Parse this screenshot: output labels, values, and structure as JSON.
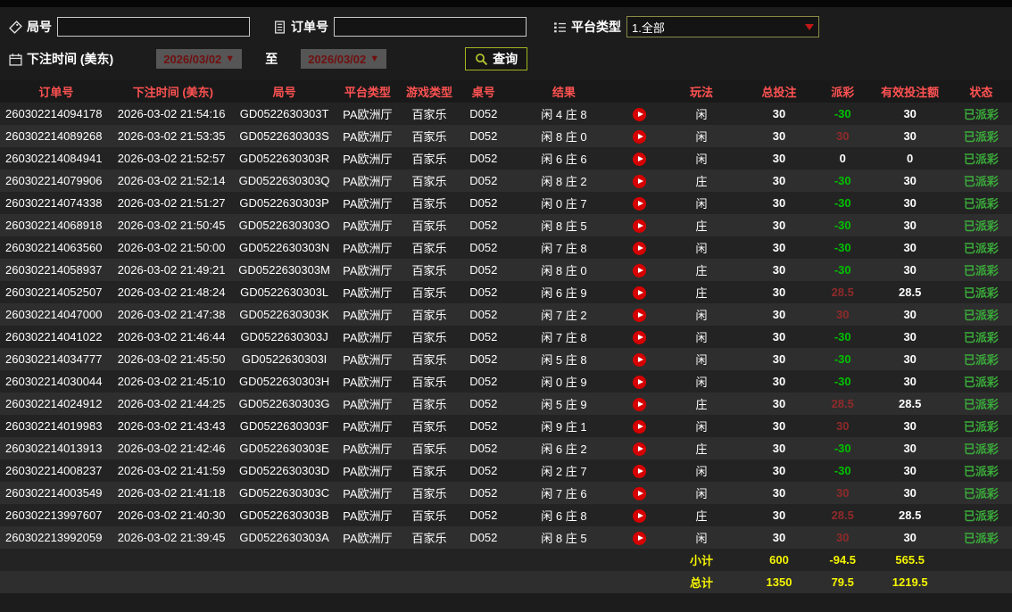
{
  "filters": {
    "round_label": "局号",
    "round_value": "",
    "order_label": "订单号",
    "order_value": "",
    "platform_label": "平台类型",
    "platform_selected": "1.全部",
    "bet_time_label": "下注时间 (美东)",
    "date_from": "2026/03/02",
    "to_label": "至",
    "date_to": "2026/03/02",
    "query_label": "查询"
  },
  "colors": {
    "header_text_red": "#ff5252",
    "negative_payout_green": "#00c000",
    "positive_payout_red": "#8f2a2a",
    "status_green": "#3aaa3a",
    "summary_yellow": "#f5f500",
    "query_border_olive": "#a3b520",
    "play_icon_red": "#d60000",
    "date_text_maroon": "#701010"
  },
  "table": {
    "headers": [
      "订单号",
      "下注时间 (美东)",
      "局号",
      "平台类型",
      "游戏类型",
      "桌号",
      "结果",
      "玩法",
      "总投注",
      "派彩",
      "有效投注额",
      "状态"
    ],
    "rows": [
      {
        "order": "260302214094178",
        "time": "2026-03-02 21:54:16",
        "round": "GD0522630303T",
        "platform": "PA欧洲厅",
        "game": "百家乐",
        "table_no": "D052",
        "result": "闲 4 庄 8",
        "play": "闲",
        "total_bet": "30",
        "payout": "-30",
        "valid_bet": "30",
        "status": "已派彩"
      },
      {
        "order": "260302214089268",
        "time": "2026-03-02 21:53:35",
        "round": "GD0522630303S",
        "platform": "PA欧洲厅",
        "game": "百家乐",
        "table_no": "D052",
        "result": "闲 8 庄 0",
        "play": "闲",
        "total_bet": "30",
        "payout": "30",
        "valid_bet": "30",
        "status": "已派彩"
      },
      {
        "order": "260302214084941",
        "time": "2026-03-02 21:52:57",
        "round": "GD0522630303R",
        "platform": "PA欧洲厅",
        "game": "百家乐",
        "table_no": "D052",
        "result": "闲 6 庄 6",
        "play": "闲",
        "total_bet": "30",
        "payout": "0",
        "valid_bet": "0",
        "status": "已派彩"
      },
      {
        "order": "260302214079906",
        "time": "2026-03-02 21:52:14",
        "round": "GD0522630303Q",
        "platform": "PA欧洲厅",
        "game": "百家乐",
        "table_no": "D052",
        "result": "闲 8 庄 2",
        "play": "庄",
        "total_bet": "30",
        "payout": "-30",
        "valid_bet": "30",
        "status": "已派彩"
      },
      {
        "order": "260302214074338",
        "time": "2026-03-02 21:51:27",
        "round": "GD0522630303P",
        "platform": "PA欧洲厅",
        "game": "百家乐",
        "table_no": "D052",
        "result": "闲 0 庄 7",
        "play": "闲",
        "total_bet": "30",
        "payout": "-30",
        "valid_bet": "30",
        "status": "已派彩"
      },
      {
        "order": "260302214068918",
        "time": "2026-03-02 21:50:45",
        "round": "GD0522630303O",
        "platform": "PA欧洲厅",
        "game": "百家乐",
        "table_no": "D052",
        "result": "闲 8 庄 5",
        "play": "庄",
        "total_bet": "30",
        "payout": "-30",
        "valid_bet": "30",
        "status": "已派彩"
      },
      {
        "order": "260302214063560",
        "time": "2026-03-02 21:50:00",
        "round": "GD0522630303N",
        "platform": "PA欧洲厅",
        "game": "百家乐",
        "table_no": "D052",
        "result": "闲 7 庄 8",
        "play": "闲",
        "total_bet": "30",
        "payout": "-30",
        "valid_bet": "30",
        "status": "已派彩"
      },
      {
        "order": "260302214058937",
        "time": "2026-03-02 21:49:21",
        "round": "GD0522630303M",
        "platform": "PA欧洲厅",
        "game": "百家乐",
        "table_no": "D052",
        "result": "闲 8 庄 0",
        "play": "庄",
        "total_bet": "30",
        "payout": "-30",
        "valid_bet": "30",
        "status": "已派彩"
      },
      {
        "order": "260302214052507",
        "time": "2026-03-02 21:48:24",
        "round": "GD0522630303L",
        "platform": "PA欧洲厅",
        "game": "百家乐",
        "table_no": "D052",
        "result": "闲 6 庄 9",
        "play": "庄",
        "total_bet": "30",
        "payout": "28.5",
        "valid_bet": "28.5",
        "status": "已派彩"
      },
      {
        "order": "260302214047000",
        "time": "2026-03-02 21:47:38",
        "round": "GD0522630303K",
        "platform": "PA欧洲厅",
        "game": "百家乐",
        "table_no": "D052",
        "result": "闲 7 庄 2",
        "play": "闲",
        "total_bet": "30",
        "payout": "30",
        "valid_bet": "30",
        "status": "已派彩"
      },
      {
        "order": "260302214041022",
        "time": "2026-03-02 21:46:44",
        "round": "GD0522630303J",
        "platform": "PA欧洲厅",
        "game": "百家乐",
        "table_no": "D052",
        "result": "闲 7 庄 8",
        "play": "闲",
        "total_bet": "30",
        "payout": "-30",
        "valid_bet": "30",
        "status": "已派彩"
      },
      {
        "order": "260302214034777",
        "time": "2026-03-02 21:45:50",
        "round": "GD0522630303I",
        "platform": "PA欧洲厅",
        "game": "百家乐",
        "table_no": "D052",
        "result": "闲 5 庄 8",
        "play": "闲",
        "total_bet": "30",
        "payout": "-30",
        "valid_bet": "30",
        "status": "已派彩"
      },
      {
        "order": "260302214030044",
        "time": "2026-03-02 21:45:10",
        "round": "GD0522630303H",
        "platform": "PA欧洲厅",
        "game": "百家乐",
        "table_no": "D052",
        "result": "闲 0 庄 9",
        "play": "闲",
        "total_bet": "30",
        "payout": "-30",
        "valid_bet": "30",
        "status": "已派彩"
      },
      {
        "order": "260302214024912",
        "time": "2026-03-02 21:44:25",
        "round": "GD0522630303G",
        "platform": "PA欧洲厅",
        "game": "百家乐",
        "table_no": "D052",
        "result": "闲 5 庄 9",
        "play": "庄",
        "total_bet": "30",
        "payout": "28.5",
        "valid_bet": "28.5",
        "status": "已派彩"
      },
      {
        "order": "260302214019983",
        "time": "2026-03-02 21:43:43",
        "round": "GD0522630303F",
        "platform": "PA欧洲厅",
        "game": "百家乐",
        "table_no": "D052",
        "result": "闲 9 庄 1",
        "play": "闲",
        "total_bet": "30",
        "payout": "30",
        "valid_bet": "30",
        "status": "已派彩"
      },
      {
        "order": "260302214013913",
        "time": "2026-03-02 21:42:46",
        "round": "GD0522630303E",
        "platform": "PA欧洲厅",
        "game": "百家乐",
        "table_no": "D052",
        "result": "闲 6 庄 2",
        "play": "庄",
        "total_bet": "30",
        "payout": "-30",
        "valid_bet": "30",
        "status": "已派彩"
      },
      {
        "order": "260302214008237",
        "time": "2026-03-02 21:41:59",
        "round": "GD0522630303D",
        "platform": "PA欧洲厅",
        "game": "百家乐",
        "table_no": "D052",
        "result": "闲 2 庄 7",
        "play": "闲",
        "total_bet": "30",
        "payout": "-30",
        "valid_bet": "30",
        "status": "已派彩"
      },
      {
        "order": "260302214003549",
        "time": "2026-03-02 21:41:18",
        "round": "GD0522630303C",
        "platform": "PA欧洲厅",
        "game": "百家乐",
        "table_no": "D052",
        "result": "闲 7 庄 6",
        "play": "闲",
        "total_bet": "30",
        "payout": "30",
        "valid_bet": "30",
        "status": "已派彩"
      },
      {
        "order": "260302213997607",
        "time": "2026-03-02 21:40:30",
        "round": "GD0522630303B",
        "platform": "PA欧洲厅",
        "game": "百家乐",
        "table_no": "D052",
        "result": "闲 6 庄 8",
        "play": "庄",
        "total_bet": "30",
        "payout": "28.5",
        "valid_bet": "28.5",
        "status": "已派彩"
      },
      {
        "order": "260302213992059",
        "time": "2026-03-02 21:39:45",
        "round": "GD0522630303A",
        "platform": "PA欧洲厅",
        "game": "百家乐",
        "table_no": "D052",
        "result": "闲 8 庄 5",
        "play": "闲",
        "total_bet": "30",
        "payout": "30",
        "valid_bet": "30",
        "status": "已派彩"
      }
    ],
    "subtotal": {
      "label": "小计",
      "total_bet": "600",
      "payout": "-94.5",
      "valid_bet": "565.5"
    },
    "grand_total": {
      "label": "总计",
      "total_bet": "1350",
      "payout": "79.5",
      "valid_bet": "1219.5"
    }
  }
}
